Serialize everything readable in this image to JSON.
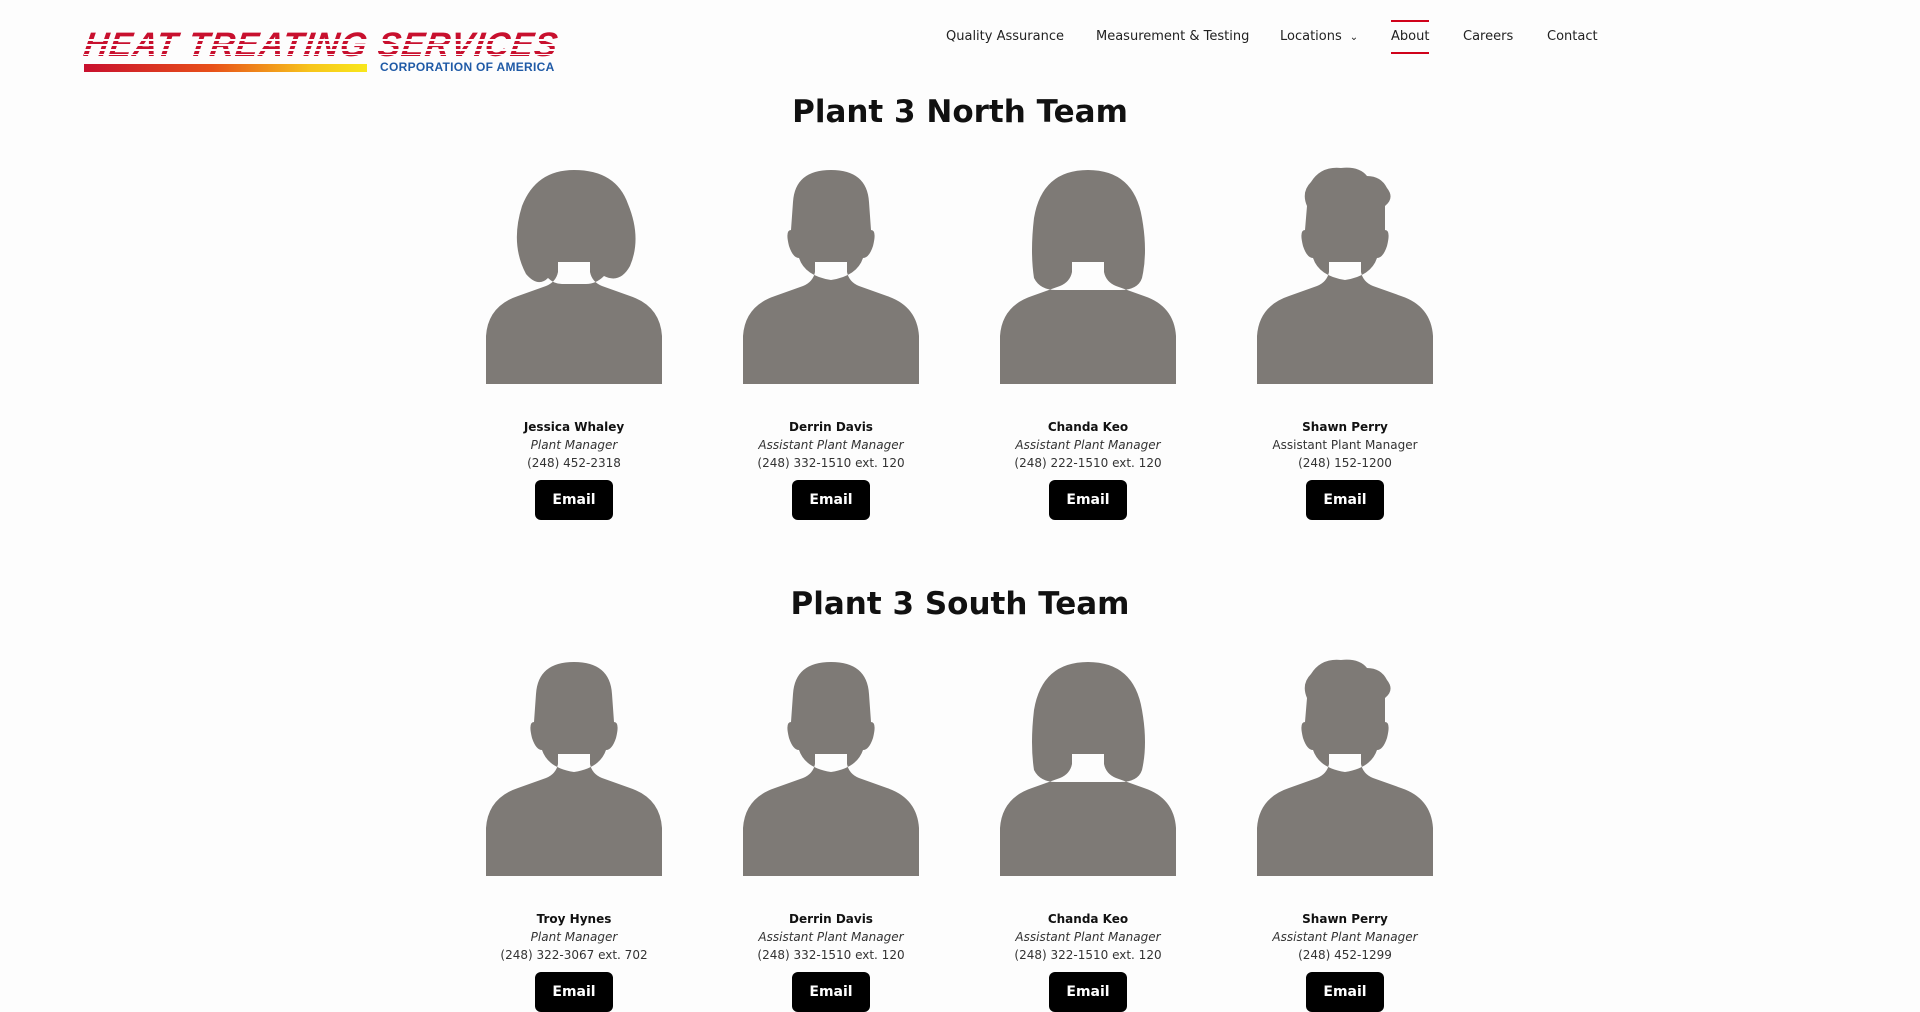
{
  "logo": {
    "main": "HEAT TREATING SERVICES",
    "sub": "CORPORATION OF AMERICA"
  },
  "nav": {
    "items": [
      "Quality Assurance",
      "Measurement & Testing",
      "Locations",
      "About",
      "Careers",
      "Contact"
    ],
    "active": "About",
    "accent": "#d0021b"
  },
  "sections": [
    {
      "title": "Plant 3 North Team",
      "members": [
        {
          "name": "Jessica Whaley",
          "role": "Plant Manager",
          "phone": "(248) 452-2318",
          "email_label": "Email",
          "avatar": "female-short-hair-icon"
        },
        {
          "name": "Derrin Davis",
          "role": "Assistant Plant Manager",
          "phone": "(248) 332-1510 ext. 120",
          "email_label": "Email",
          "avatar": "male-icon"
        },
        {
          "name": "Chanda Keo",
          "role": "Assistant Plant Manager",
          "phone": "(248) 222-1510 ext. 120",
          "email_label": "Email",
          "avatar": "female-bob-icon"
        },
        {
          "name": "Shawn Perry",
          "role": "Assistant Plant Manager",
          "phone": "(248) 152-1200",
          "email_label": "Email",
          "avatar": "male-spiky-hair-icon"
        }
      ]
    },
    {
      "title": "Plant 3 South Team",
      "members": [
        {
          "name": "Troy Hynes",
          "role": "Plant Manager",
          "phone": "(248) 322-3067 ext. 702",
          "email_label": "Email",
          "avatar": "male-icon"
        },
        {
          "name": "Derrin Davis",
          "role": "Assistant Plant Manager",
          "phone": "(248) 332-1510 ext. 120",
          "email_label": "Email",
          "avatar": "male-icon"
        },
        {
          "name": "Chanda Keo",
          "role": "Assistant Plant Manager",
          "phone": "(248) 322-1510 ext. 120",
          "email_label": "Email",
          "avatar": "female-bob-icon"
        },
        {
          "name": "Shawn Perry",
          "role": "Assistant Plant Manager",
          "phone": "(248) 452-1299",
          "email_label": "Email",
          "avatar": "male-spiky-hair-icon"
        }
      ]
    }
  ],
  "colors": {
    "silhouette": "#7e7a76",
    "button_bg": "#000000",
    "brand_red": "#c8102e",
    "brand_blue": "#1f5aa6"
  }
}
